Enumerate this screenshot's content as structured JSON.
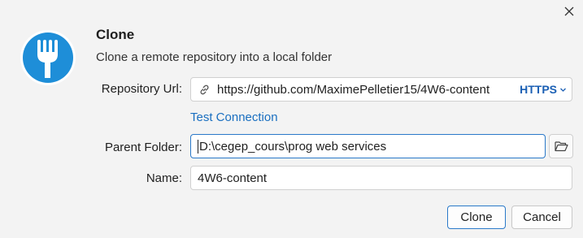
{
  "dialog": {
    "title": "Clone",
    "subtitle": "Clone a remote repository into a local folder",
    "icons": {
      "app": "fork-icon",
      "close": "close-icon",
      "link": "link-icon",
      "folder": "folder-icon",
      "dropdown": "chevron-down-icon"
    },
    "colors": {
      "accent": "#1a6fc0",
      "logo_blue": "#1e8ed8",
      "background": "#f3f3f3"
    }
  },
  "form": {
    "repository_url": {
      "label": "Repository Url:",
      "value": "https://github.com/MaximePelletier15/4W6-content",
      "protocol": "HTTPS"
    },
    "test_connection_label": "Test Connection",
    "parent_folder": {
      "label": "Parent Folder:",
      "value": "D:\\cegep_cours\\prog web services"
    },
    "name": {
      "label": "Name:",
      "value": "4W6-content"
    }
  },
  "buttons": {
    "clone": "Clone",
    "cancel": "Cancel"
  }
}
